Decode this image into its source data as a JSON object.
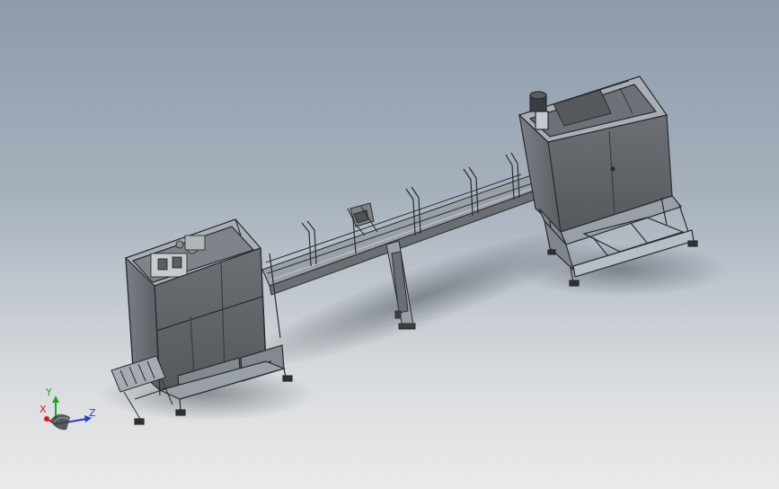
{
  "scene": {
    "description_colors": {
      "background_top": "#8d9bab",
      "background_bottom": "#e9eaeb",
      "cabinet_panel": "#5e6166",
      "frame_edge": "#2a2c30",
      "frame_light": "#b9bfc6",
      "shadow": "#5b6169"
    }
  },
  "triad": {
    "x_label": "X",
    "y_label": "Y",
    "z_label": "Z",
    "x_color": "#d21c1c",
    "y_color": "#1fa51f",
    "z_color": "#2b3fc4"
  }
}
